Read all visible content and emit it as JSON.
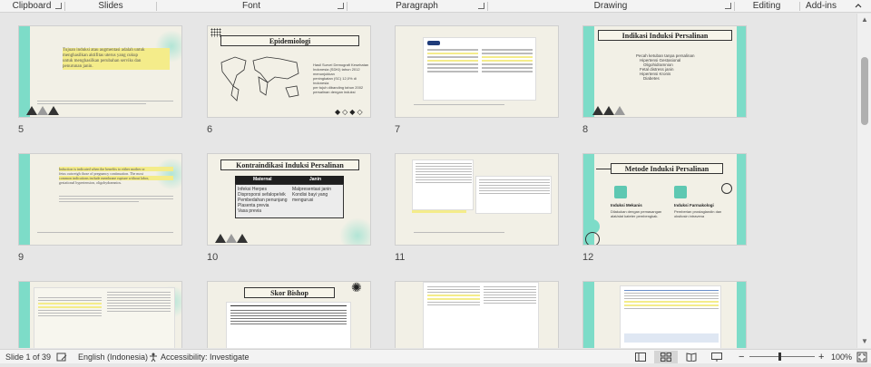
{
  "ribbon": {
    "groups": [
      "Clipboard",
      "Slides",
      "Font",
      "Paragraph",
      "Drawing",
      "Editing",
      "Add-ins"
    ]
  },
  "slides": [
    {
      "number": "5",
      "title": "",
      "lines": [
        "Tujuan induksi atau augmentasi adalah untuk",
        "menghasilkan aktifitas uterus yang cukup",
        "untuk menghasilkan perubahan serviks dan",
        "penurunan janin."
      ]
    },
    {
      "number": "6",
      "title": "Epidemiologi",
      "lines": [
        "Hasil Survei Demografi Kesehatan",
        "Indonesia (SDKI) tahun 2012 menunjukkan",
        "peningkatan (SC) 12,0% di Indonesia",
        "per tujuh dibanding tahun 2002",
        "persalinan dengan induksi"
      ]
    },
    {
      "number": "7",
      "title": "",
      "lines": []
    },
    {
      "number": "8",
      "title": "Indikasi Induksi Persalinan",
      "lines": [
        "Pecah ketuban tanpa persalinan",
        "Hipertensi Gestasional",
        "Oligohidramnion",
        "Fetal distress janin",
        "Hipertensi Kronis",
        "Diabetes"
      ]
    },
    {
      "number": "9",
      "title": "",
      "lines": [
        "Induction is indicated when the benefits to either mother or",
        "fetus outweigh those of pregnancy continuation. The most",
        "common indications include membrane rupture without labor,",
        "gestational hypertension, oligohydramnios."
      ]
    },
    {
      "number": "10",
      "title": "Kontraindikasi Induksi Persalinan",
      "table_head": [
        "Maternal",
        "Janin"
      ],
      "table_left": [
        "Infeksi Herpes",
        "Disproporsi sefalopelvik",
        "Pembedahan penunjang",
        "Plasenta previa",
        "Vasa previa"
      ],
      "table_right": [
        "Malpresentasi janin",
        "Kondisi bayi yang",
        "mengurusi"
      ]
    },
    {
      "number": "11",
      "title": "",
      "lines": []
    },
    {
      "number": "12",
      "title": "Metode Induksi Persalinan",
      "left_head": "Induksi Mekanis",
      "left_text": "Dilakukan dengan pemasangan alat/alat kateter pembengkak.",
      "right_head": "Induksi Farmakologi",
      "right_text": "Pemberian prostaglandin dan oksitosin intravena"
    },
    {
      "number": "",
      "title": "",
      "lines": []
    },
    {
      "number": "",
      "title": "Skor Bishop",
      "lines": []
    },
    {
      "number": "",
      "title": "",
      "lines": []
    },
    {
      "number": "",
      "title": "",
      "lines": []
    }
  ],
  "status": {
    "slide_info": "Slide 1 of 39",
    "language": "English (Indonesia)",
    "accessibility": "Accessibility: Investigate",
    "zoom": "100%",
    "zoom_minus": "−",
    "zoom_plus": "+"
  },
  "colors": {
    "accent": "#7ddcc8",
    "highlight": "#f4ec8a",
    "dark": "#1f1f1f"
  }
}
